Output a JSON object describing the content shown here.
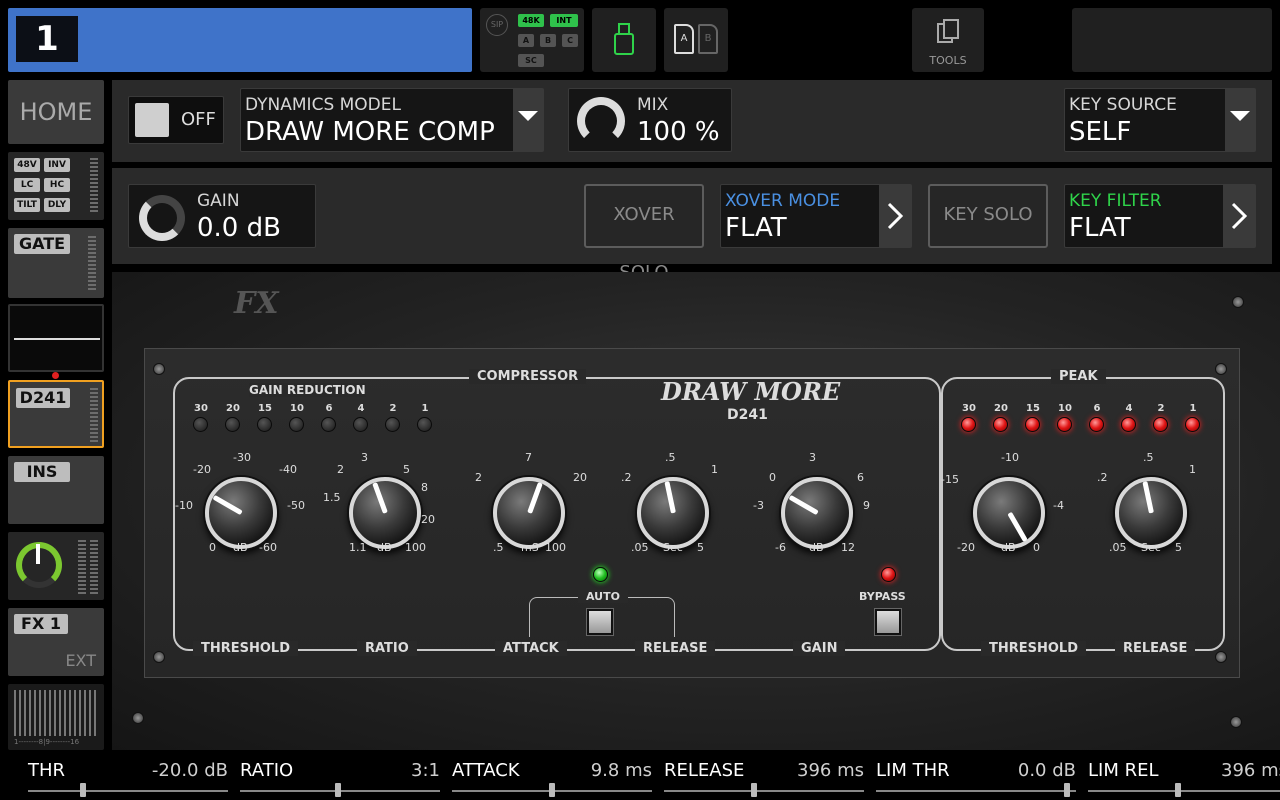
{
  "channel": {
    "number": "1"
  },
  "top": {
    "sip": "SIP",
    "rate_48k": "48K",
    "int": "INT",
    "a": "A",
    "b": "B",
    "c": "C",
    "sc": "SC",
    "ab_a": "A",
    "ab_b": "B",
    "tools": "TOOLS"
  },
  "side": {
    "home": "HOME",
    "tags": [
      "48V",
      "INV",
      "LC",
      "HC",
      "TILT",
      "DLY"
    ],
    "gate": "GATE",
    "d241": "D241",
    "ins": "INS",
    "fx1": "FX 1",
    "ext": "EXT",
    "meter_scale": "1--------8|9--------16"
  },
  "header": {
    "off": "OFF",
    "model_label": "DYNAMICS MODEL",
    "model_value": "DRAW MORE COMP",
    "mix_label": "MIX",
    "mix_value": "100 %",
    "key_source_label": "KEY SOURCE",
    "key_source_value": "SELF",
    "gain_label": "GAIN",
    "gain_value": "0.0 dB",
    "xover_solo": "XOVER SOLO",
    "xover_mode_label": "XOVER MODE",
    "xover_mode_value": "FLAT",
    "key_solo": "KEY SOLO",
    "key_filter_label": "KEY FILTER",
    "key_filter_value": "FLAT",
    "accent_blue": "#4a90e2",
    "accent_green": "#2fd34a"
  },
  "plugin": {
    "logo": "FX",
    "brand": "DRAW MORE",
    "model": "D241",
    "compressor_title": "COMPRESSOR",
    "peak_title": "PEAK",
    "gain_reduction": "GAIN REDUCTION",
    "gr_leds": [
      "30",
      "20",
      "15",
      "10",
      "6",
      "4",
      "2",
      "1"
    ],
    "peak_leds": [
      "30",
      "20",
      "15",
      "10",
      "6",
      "4",
      "2",
      "1"
    ],
    "auto": "AUTO",
    "bypass": "BYPASS",
    "controls": {
      "threshold": "THRESHOLD",
      "ratio": "RATIO",
      "attack": "ATTACK",
      "release": "RELEASE",
      "gain": "GAIN",
      "peak_threshold": "THRESHOLD",
      "peak_release": "RELEASE"
    },
    "scales": {
      "thr": [
        "-30",
        "-20",
        "-40",
        "-10",
        "-50",
        "0",
        "dB",
        "-60"
      ],
      "ratio": [
        "3",
        "2",
        "5",
        "1.5",
        "8",
        "20",
        "1.1",
        "dB",
        "100"
      ],
      "attack": [
        "7",
        "2",
        "20",
        ".5",
        "mS",
        "100"
      ],
      "release": [
        ".5",
        ".2",
        "1",
        ".05",
        "Sec",
        "5"
      ],
      "gain": [
        "3",
        "0",
        "6",
        "-3",
        "9",
        "-6",
        "dB",
        "12"
      ],
      "pthr": [
        "-10",
        "-15",
        "-4",
        "-20",
        "dB",
        "0"
      ],
      "prel": [
        ".5",
        ".2",
        "1",
        ".05",
        "Sec",
        "5"
      ]
    }
  },
  "bottom": [
    {
      "name": "THR",
      "value": "-20.0 dB",
      "pos": 0.27
    },
    {
      "name": "RATIO",
      "value": "3:1",
      "pos": 0.49
    },
    {
      "name": "ATTACK",
      "value": "9.8 ms",
      "pos": 0.5
    },
    {
      "name": "RELEASE",
      "value": "396 ms",
      "pos": 0.45
    },
    {
      "name": "LIM THR",
      "value": "0.0 dB",
      "pos": 0.97
    },
    {
      "name": "LIM REL",
      "value": "396 ms",
      "pos": 0.45
    }
  ]
}
